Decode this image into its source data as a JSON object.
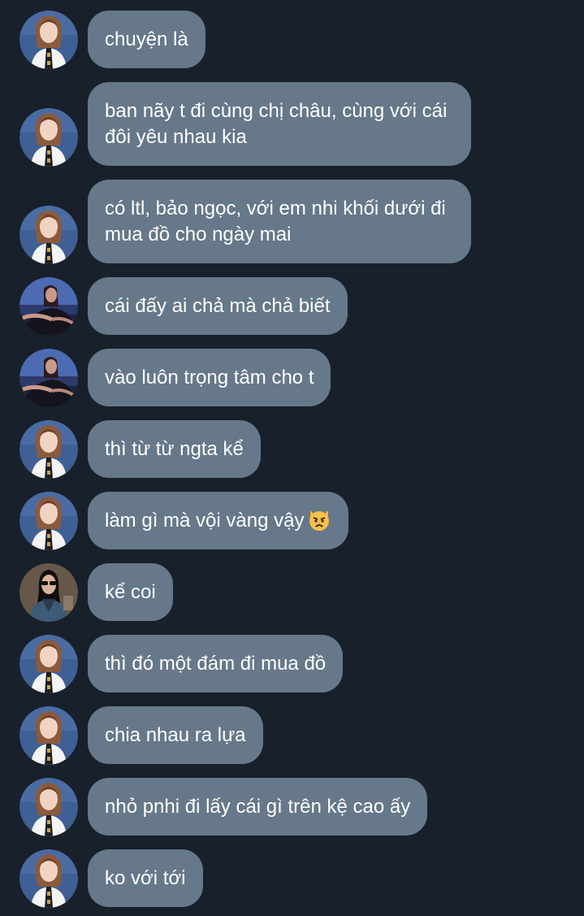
{
  "messages": [
    {
      "text": "chuyện là",
      "avatar": "woman-blonde-avatar"
    },
    {
      "text": "ban nãy t đi cùng chị châu, cùng với cái đôi yêu nhau kia",
      "avatar": "woman-blonde-avatar"
    },
    {
      "text": "có ltl, bảo ngọc, với em nhi khối dưới đi mua đồ cho ngày mai",
      "avatar": "woman-blonde-avatar"
    },
    {
      "text": "cái đấy ai chả mà chả biết",
      "avatar": "woman-dark-blue-avatar"
    },
    {
      "text": "vào luôn trọng tâm cho t",
      "avatar": "woman-dark-blue-avatar"
    },
    {
      "text": "thì từ từ ngta kể",
      "avatar": "woman-blonde-avatar"
    },
    {
      "text": "làm gì mà vội vàng vậy",
      "emoji": "pouting-cat-emoji",
      "avatar": "woman-blonde-avatar"
    },
    {
      "text": "kể coi",
      "avatar": "person-sunglasses-avatar"
    },
    {
      "text": "thì đó một đám đi mua đồ",
      "avatar": "woman-blonde-avatar"
    },
    {
      "text": "chia nhau ra lựa",
      "avatar": "woman-blonde-avatar"
    },
    {
      "text": "nhỏ pnhi đi lấy cái gì trên kệ cao ấy",
      "avatar": "woman-blonde-avatar"
    },
    {
      "text": "ko với tới",
      "avatar": "woman-blonde-avatar"
    }
  ],
  "colors": {
    "background": "#18202b",
    "bubble": "#667889",
    "text": "#ffffff"
  }
}
